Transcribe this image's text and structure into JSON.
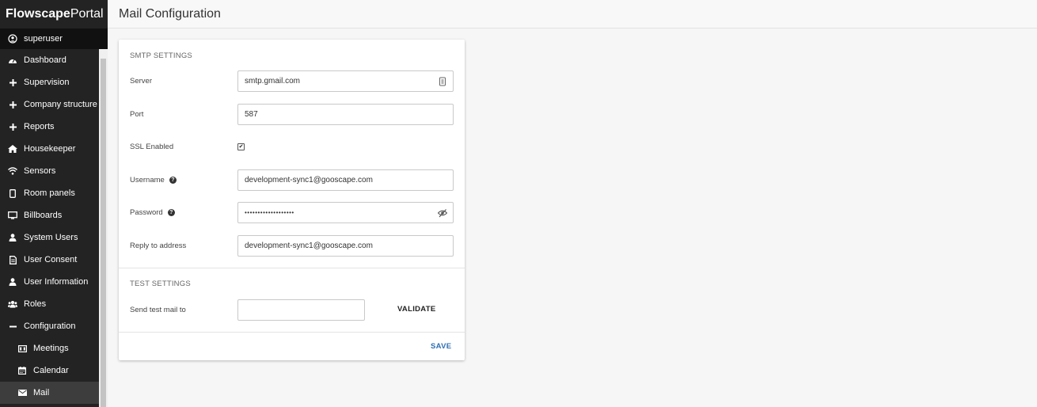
{
  "brand": {
    "bold": "Flowscape",
    "regular": "Portal"
  },
  "user": {
    "name": "superuser",
    "icon": "user-circle-icon"
  },
  "sidebar": {
    "items": [
      {
        "label": "Dashboard",
        "icon": "dashboard-icon"
      },
      {
        "label": "Supervision",
        "icon": "plus-icon"
      },
      {
        "label": "Company structure",
        "icon": "plus-icon"
      },
      {
        "label": "Reports",
        "icon": "plus-icon"
      },
      {
        "label": "Housekeeper",
        "icon": "home-icon"
      },
      {
        "label": "Sensors",
        "icon": "wifi-icon"
      },
      {
        "label": "Room panels",
        "icon": "tablet-icon"
      },
      {
        "label": "Billboards",
        "icon": "monitor-icon"
      },
      {
        "label": "System Users",
        "icon": "user-icon"
      },
      {
        "label": "User Consent",
        "icon": "document-icon"
      },
      {
        "label": "User Information",
        "icon": "user-icon"
      },
      {
        "label": "Roles",
        "icon": "users-icon"
      },
      {
        "label": "Configuration",
        "icon": "minus-icon"
      }
    ],
    "subitems": [
      {
        "label": "Meetings",
        "icon": "meetings-icon"
      },
      {
        "label": "Calendar",
        "icon": "calendar-icon"
      },
      {
        "label": "Mail",
        "icon": "mail-icon",
        "active": true
      }
    ]
  },
  "header": {
    "title": "Mail Configuration"
  },
  "smtp": {
    "section_title": "SMTP SETTINGS",
    "server_label": "Server",
    "server_value": "smtp.gmail.com",
    "port_label": "Port",
    "port_value": "587",
    "ssl_label": "SSL Enabled",
    "ssl_enabled": true,
    "ssl_check_glyph": "✔",
    "username_label": "Username",
    "username_value": "development-sync1@gooscape.com",
    "password_label": "Password",
    "password_value": "•••••••••••••••••••",
    "reply_label": "Reply to address",
    "reply_value": "development-sync1@gooscape.com",
    "help_glyph": "?"
  },
  "test": {
    "section_title": "TEST SETTINGS",
    "send_label": "Send test mail to",
    "send_value": "",
    "validate_label": "VALIDATE"
  },
  "actions": {
    "save_label": "SAVE"
  },
  "colors": {
    "sidebar_bg": "#232323",
    "accent": "#2f6fb2"
  }
}
